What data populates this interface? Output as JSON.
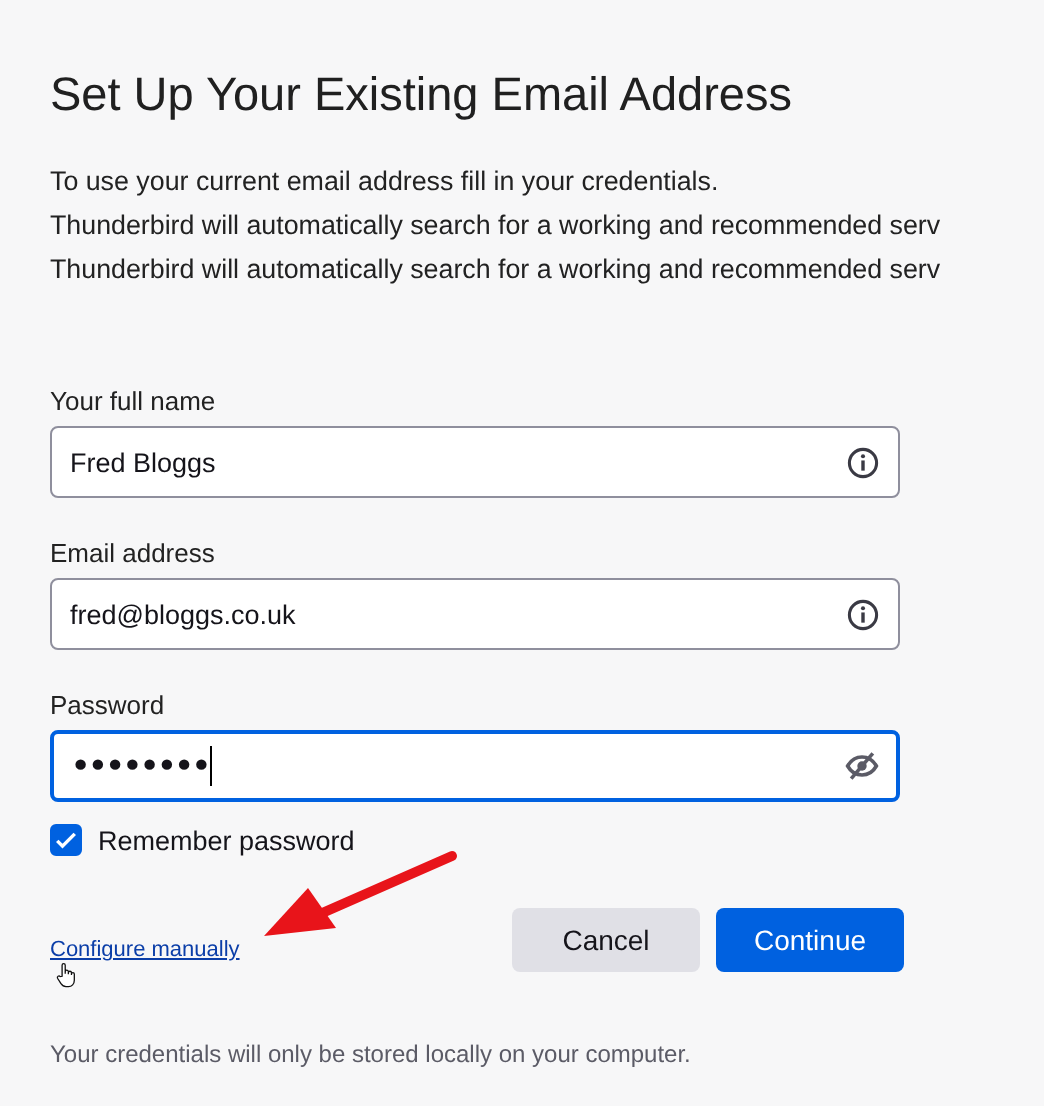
{
  "title": "Set Up Your Existing Email Address",
  "intro": [
    "To use your current email address fill in your credentials.",
    "Thunderbird will automatically search for a working and recommended serv",
    "Thunderbird will automatically search for a working and recommended serv"
  ],
  "fields": [
    {
      "label": "Your full name",
      "value": "Fred Bloggs",
      "kind": "text",
      "focused": false
    },
    {
      "label": "Email address",
      "value": "fred@bloggs.co.uk",
      "kind": "text",
      "focused": false
    },
    {
      "label": "Password",
      "value": "••••••••",
      "kind": "password",
      "focused": true
    }
  ],
  "remember": {
    "label": "Remember password",
    "checked": true
  },
  "link": "Configure manually",
  "buttons": [
    {
      "label": "Cancel",
      "kind": "secondary"
    },
    {
      "label": "Continue",
      "kind": "primary"
    }
  ],
  "note": "Your credentials will only be stored locally on your computer."
}
